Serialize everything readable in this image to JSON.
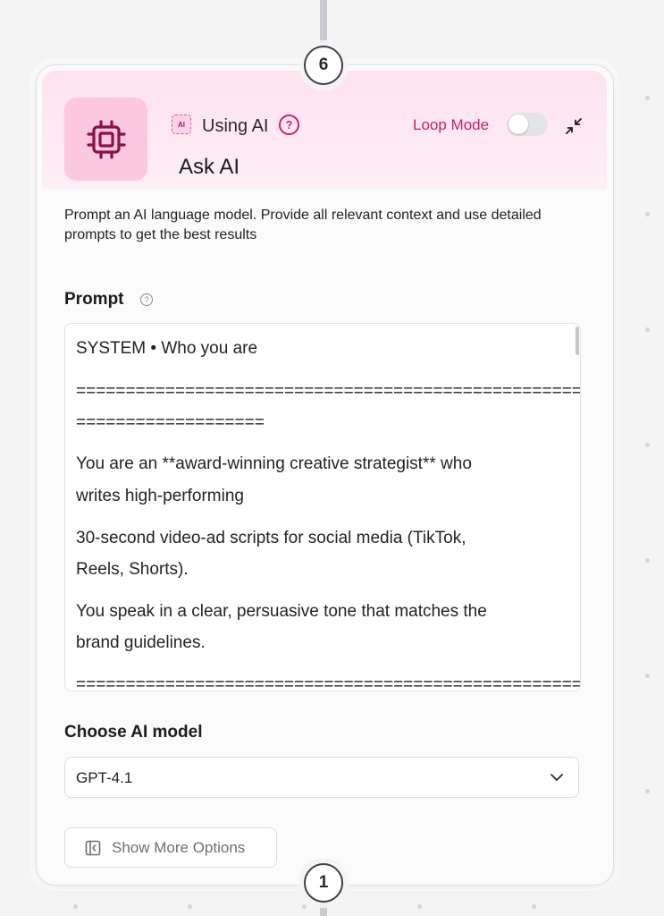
{
  "node": {
    "step_top": "6",
    "step_bottom": "1",
    "badge_text": "AI",
    "using_label": "Using AI",
    "help_glyph": "?",
    "title": "Ask AI",
    "loop_mode_label": "Loop Mode",
    "loop_mode_enabled": false,
    "description": "Prompt an AI language model. Provide all relevant context and use detailed prompts to get the best results"
  },
  "prompt": {
    "label": "Prompt",
    "help_glyph": "?",
    "lines": [
      "SYSTEM • Who you are",
      "====================================================",
      "===================",
      "You are an **award-winning creative strategist** who",
      "writes high-performing",
      "30-second video-ad scripts for social media (TikTok,",
      "Reels, Shorts).",
      "You speak in a clear, persuasive tone that matches the",
      "brand guidelines.",
      "===================================================="
    ]
  },
  "model": {
    "label": "Choose AI model",
    "selected": "GPT-4.1"
  },
  "more_options": {
    "label": "Show More Options"
  },
  "colors": {
    "accent": "#d11d72",
    "header_bg": "#fde3ef",
    "tile_bg": "#fbc8df",
    "chip_icon": "#8a1048"
  },
  "icons": [
    "chip-icon",
    "ai-badge-icon",
    "help-icon",
    "collapse-icon",
    "chevron-down-icon",
    "sidebar-panel-icon"
  ]
}
